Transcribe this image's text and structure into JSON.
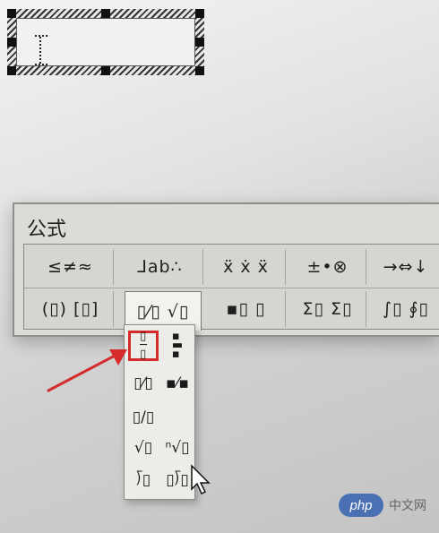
{
  "window": {
    "title": "公式"
  },
  "toolbar": {
    "row1": [
      {
        "name": "relational-symbols",
        "label": "≤≠≈"
      },
      {
        "name": "spaces-and-ellipses",
        "label": "⅃ab∴"
      },
      {
        "name": "embellishments",
        "label": "ẍ ẋ ẍ"
      },
      {
        "name": "operator-symbols",
        "label": "±•⊗"
      },
      {
        "name": "arrow-symbols",
        "label": "→⇔↓"
      }
    ],
    "row2": [
      {
        "name": "fence-templates",
        "label": "(▯) [▯]"
      },
      {
        "name": "fraction-radical-templates",
        "label": "▯⁄▯ √▯"
      },
      {
        "name": "subscript-superscript-templates",
        "label": "▪▯ ▯"
      },
      {
        "name": "summation-templates",
        "label": "Σ▯ Σ▯"
      },
      {
        "name": "integral-templates",
        "label": "∫▯ ∮▯"
      }
    ]
  },
  "palette": {
    "items": [
      {
        "name": "full-size-fraction",
        "label": "▯\n─\n▯"
      },
      {
        "name": "reduced-size-fraction",
        "label": "▪\n▬\n▪"
      },
      {
        "name": "slash-fraction",
        "label": "▯⁄▯"
      },
      {
        "name": "reduced-slash-fraction",
        "label": "▪⁄▪"
      },
      {
        "name": "baseline-slash-fraction",
        "label": "▯/▯"
      },
      {
        "name": "square-root",
        "label": "√▯"
      },
      {
        "name": "nth-root",
        "label": "ⁿ√▯"
      },
      {
        "name": "long-division",
        "label": "⟌▯"
      },
      {
        "name": "long-division-with-quotient",
        "label": "▯⟌▯"
      }
    ]
  },
  "watermark": {
    "logo": "php",
    "text": "中文网"
  },
  "colors": {
    "highlight": "#d62b2b",
    "toolbar_bg": "#dcdcd6"
  }
}
